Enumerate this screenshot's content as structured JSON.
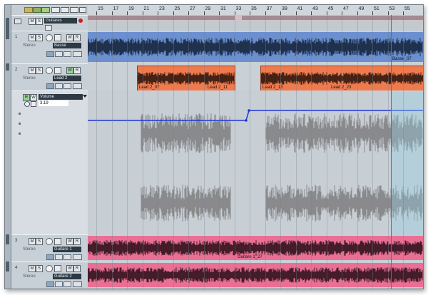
{
  "ruler": {
    "markers": [
      "15",
      "17",
      "19",
      "21",
      "23",
      "25",
      "27",
      "29",
      "31",
      "33",
      "35",
      "37",
      "39",
      "41",
      "43",
      "45",
      "47",
      "49",
      "51",
      "53",
      "55"
    ]
  },
  "folder": {
    "name": "Guitares"
  },
  "tracks": [
    {
      "id": "bass",
      "name": "Basse",
      "sub": "Stereo",
      "number": "1"
    },
    {
      "id": "lead",
      "name": "Lead 2",
      "sub": "Stereo",
      "number": "2"
    },
    {
      "id": "g1",
      "name": "Guitare 1",
      "sub": "Stereo",
      "number": "3"
    },
    {
      "id": "g2",
      "name": "Guitare 2",
      "sub": "Stereo",
      "number": "4"
    }
  ],
  "automation": {
    "param": "Volume",
    "value": "3.19"
  },
  "clips": {
    "bass_end": "Basse_07",
    "lead_a": "Lead 2_07",
    "lead_b": "Lead 2_11",
    "lead_c": "Lead 2_13",
    "lead_d": "Lead 2_23",
    "guitar1": "Guitare 1_27"
  },
  "buttons": {
    "mute": "M",
    "solo": "S",
    "write": "W",
    "read": "R",
    "folder_mute": "M",
    "folder_solo": "S",
    "auto_read": "R",
    "auto_write": "W"
  },
  "colors": {
    "bass_clip": "#6b8fcf",
    "lead_clip": "#ee7a4e",
    "guitar_clip": "#ea6f94",
    "automation_line": "#1f37d6",
    "waveform": "#7a7a7a"
  }
}
